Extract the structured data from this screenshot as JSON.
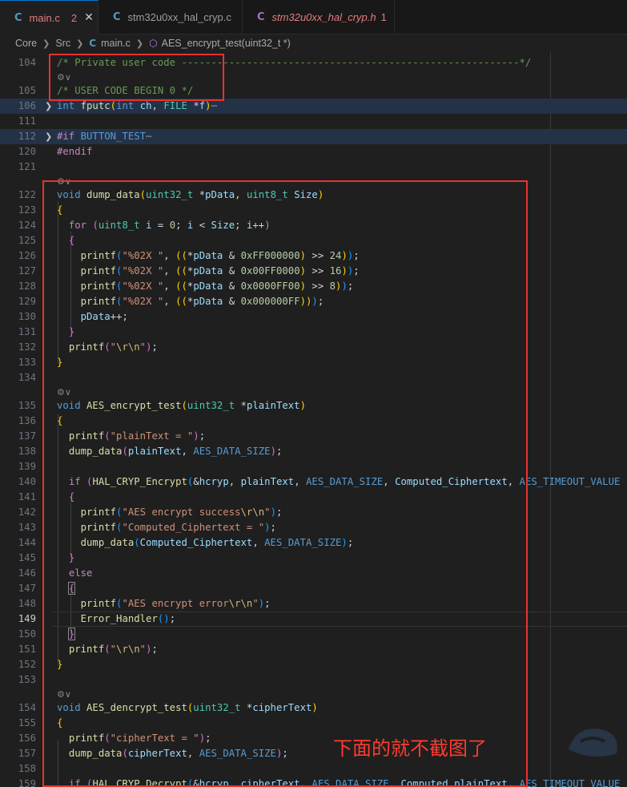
{
  "tabs": [
    {
      "label": "main.c",
      "badge": "2",
      "close": "✕",
      "type": "c",
      "active": true
    },
    {
      "label": "stm32u0xx_hal_cryp.c",
      "type": "c",
      "active": false
    },
    {
      "label": "stm32u0xx_hal_cryp.h",
      "badge": "1",
      "type": "h",
      "active": false
    }
  ],
  "breadcrumb": {
    "items": [
      "Core",
      "Src",
      "main.c",
      "AES_encrypt_test(uint32_t *)"
    ]
  },
  "current_line": "149",
  "note": "下面的就不截图了"
}
